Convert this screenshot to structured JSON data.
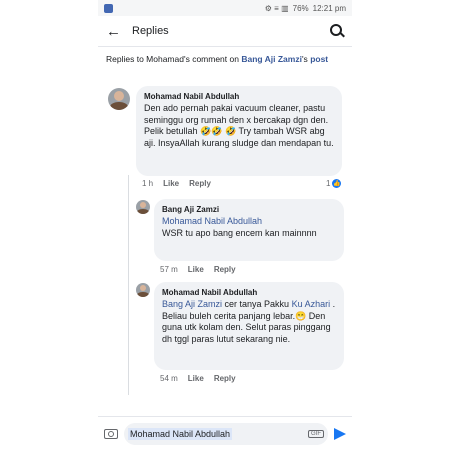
{
  "status": {
    "icons": "⚙ ≡ ▥",
    "battery": "76%",
    "time": "12:21 pm"
  },
  "header": {
    "title": "Replies"
  },
  "context": {
    "prefix": "Replies to Mohamad's comment on ",
    "author_link": "Bang Aji Zamzi",
    "suffix": "'s",
    "post_link": "post"
  },
  "comments": [
    {
      "name": "Mohamad Nabil Abdullah",
      "text": "Den ado pernah pakai vacuum cleaner, pastu seminggu org rumah den x bercakap dgn den. Pelik betullah 🤣🤣 🤣 Try tambah WSR abg aji. InsyaAllah kurang sludge dan mendapan tu.",
      "time": "1 h",
      "like": "Like",
      "reply": "Reply",
      "reactions": "1"
    },
    {
      "name": "Bang Aji Zamzi",
      "mention": "Mohamad Nabil Abdullah",
      "text": "WSR tu apo bang encem kan mainnnn",
      "time": "57 m",
      "like": "Like",
      "reply": "Reply"
    },
    {
      "name": "Mohamad Nabil Abdullah",
      "mention1": "Bang Aji Zamzi",
      "text1": " cer tanya Pakku ",
      "mention2": "Ku Azhari",
      "text2": " . Beliau buleh cerita panjang lebar.😁 Den guna utk kolam den. Selut paras pinggang dh tggl paras lutut sekarang nie.",
      "time": "54 m",
      "like": "Like",
      "reply": "Reply"
    }
  ],
  "composer": {
    "value": "Mohamad Nabil Abdullah",
    "gif": "GIF"
  },
  "colors": {
    "link": "#385898",
    "bubble": "#f0f2f5",
    "accent": "#1877f2"
  }
}
